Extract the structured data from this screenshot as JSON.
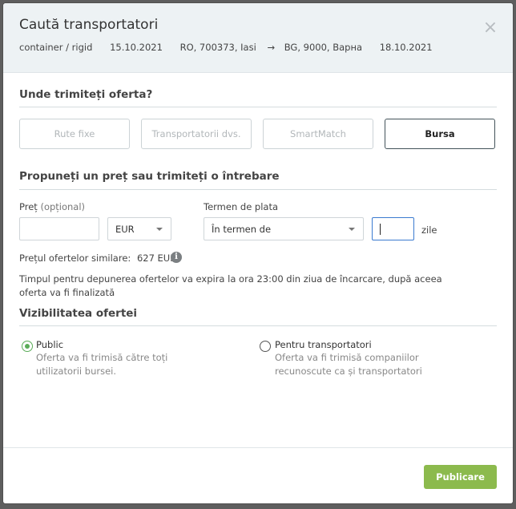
{
  "header": {
    "title": "Caută transportatori",
    "close_icon": "×",
    "route": {
      "vehicle": "container / rigid",
      "load_date": "15.10.2021",
      "origin": "RO, 700373, Iasi",
      "arrow_icon": "→",
      "destination": "BG, 9000, Варна",
      "unload_date": "18.10.2021"
    }
  },
  "send_to": {
    "title": "Unde trimiteți oferta?",
    "options": [
      "Rute fixe",
      "Transportatorii dvs.",
      "SmartMatch",
      "Bursa"
    ],
    "selected": "Bursa"
  },
  "offer": {
    "title": "Propuneți un preț sau trimiteți o întrebare",
    "price_label": "Preț",
    "price_optional": "(opțional)",
    "price_value": "",
    "currency": "EUR",
    "payment_label": "Termen de plata",
    "payment_value": "În termen de",
    "days_value": "",
    "days_unit": "zile",
    "similar_label": "Prețul ofertelor similare:",
    "similar_value": "627 EUR",
    "info_icon": "i",
    "deadline_note": "Timpul pentru depunerea ofertelor va expira la ora 23:00 din ziua de încarcare, după aceea oferta va fi finalizată"
  },
  "visibility": {
    "title": "Vizibilitatea ofertei",
    "public": {
      "label": "Public",
      "desc_line1": "Oferta va fi trimisă către toți",
      "desc_line2": "utilizatorii bursei.",
      "checked": true
    },
    "carriers": {
      "label": "Pentru transportatori",
      "desc_line1": "Oferta va fi trimisă companiilor",
      "desc_line2": "recunoscute ca și transportatori",
      "checked": false
    }
  },
  "footer": {
    "publish_label": "Publicare"
  },
  "colors": {
    "accent_green": "#8cba4d",
    "radio_green": "#5aac58",
    "header_bg": "#edf2f4"
  }
}
